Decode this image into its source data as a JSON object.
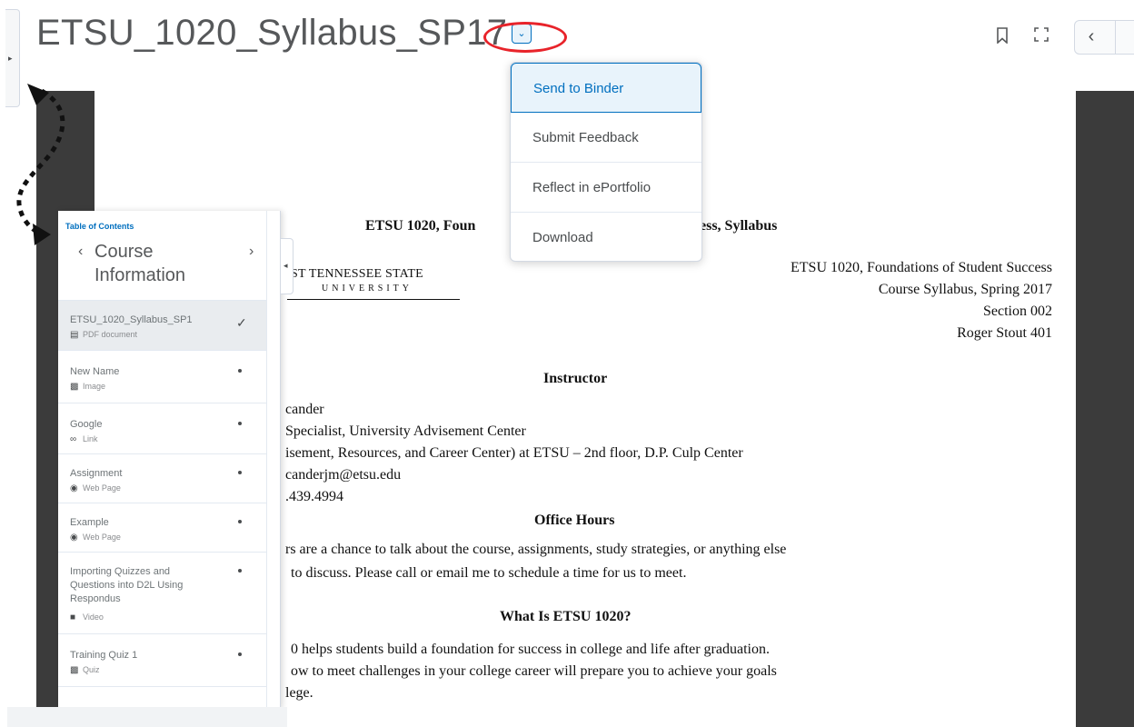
{
  "header": {
    "title": "ETSU_1020_Syllabus_SP17",
    "dropdown_icon": "chevron-down-icon",
    "bookmark_icon": "bookmark-icon",
    "fullscreen_icon": "expand-icon",
    "prev_icon": "chevron-left-icon",
    "annotation_color": "#e8232a"
  },
  "context_menu": {
    "items": [
      {
        "label": "Send to Binder"
      },
      {
        "label": "Submit Feedback"
      },
      {
        "label": "Reflect in ePortfolio"
      },
      {
        "label": "Download"
      }
    ]
  },
  "toc": {
    "label": "Table of Contents",
    "title": "Course Information",
    "items": [
      {
        "name": "ETSU_1020_Syllabus_SP1",
        "type": "PDF document",
        "icon": "document-icon",
        "status": "completed"
      },
      {
        "name": "New Name",
        "type": "Image",
        "icon": "image-icon",
        "status": "unread"
      },
      {
        "name": "Google",
        "type": "Link",
        "icon": "link-icon",
        "status": "unread"
      },
      {
        "name": "Assignment",
        "type": "Web Page",
        "icon": "globe-icon",
        "status": "unread"
      },
      {
        "name": "Example",
        "type": "Web Page",
        "icon": "globe-icon",
        "status": "unread"
      },
      {
        "name": "Importing Quizzes and Questions into D2L Using Respondus",
        "type": "Video",
        "icon": "video-icon",
        "status": "unread"
      },
      {
        "name": "Training Quiz 1",
        "type": "Quiz",
        "icon": "quiz-icon",
        "status": "unread"
      }
    ]
  },
  "document": {
    "heading_left": "ETSU 1020, Foun",
    "heading_right": "ess, Syllabus",
    "logo_line1": "ST TENNESSEE STATE",
    "logo_line2": "UNIVERSITY",
    "course_info": [
      "ETSU 1020, Foundations of Student Success",
      "Course Syllabus, Spring 2017",
      "Section 002",
      "Roger Stout 401"
    ],
    "instructor_heading": "Instructor",
    "instructor_lines": [
      "cander",
      "Specialist, University Advisement Center",
      "isement, Resources, and Career Center) at ETSU – 2nd floor, D.P. Culp Center",
      "canderjm@etsu.edu",
      ".439.4994"
    ],
    "office_hours_heading": "Office Hours",
    "office_hours_lines": [
      "rs are a chance to talk about the course, assignments, study strategies, or anything else",
      "to discuss.  Please call or email me to schedule a time for us to meet."
    ],
    "what_heading": "What Is ETSU 1020?",
    "what_lines": [
      "0 helps students build a foundation for success in college and life after graduation.",
      "ow to meet challenges in your college career will prepare you to achieve your goals",
      "lege."
    ]
  }
}
